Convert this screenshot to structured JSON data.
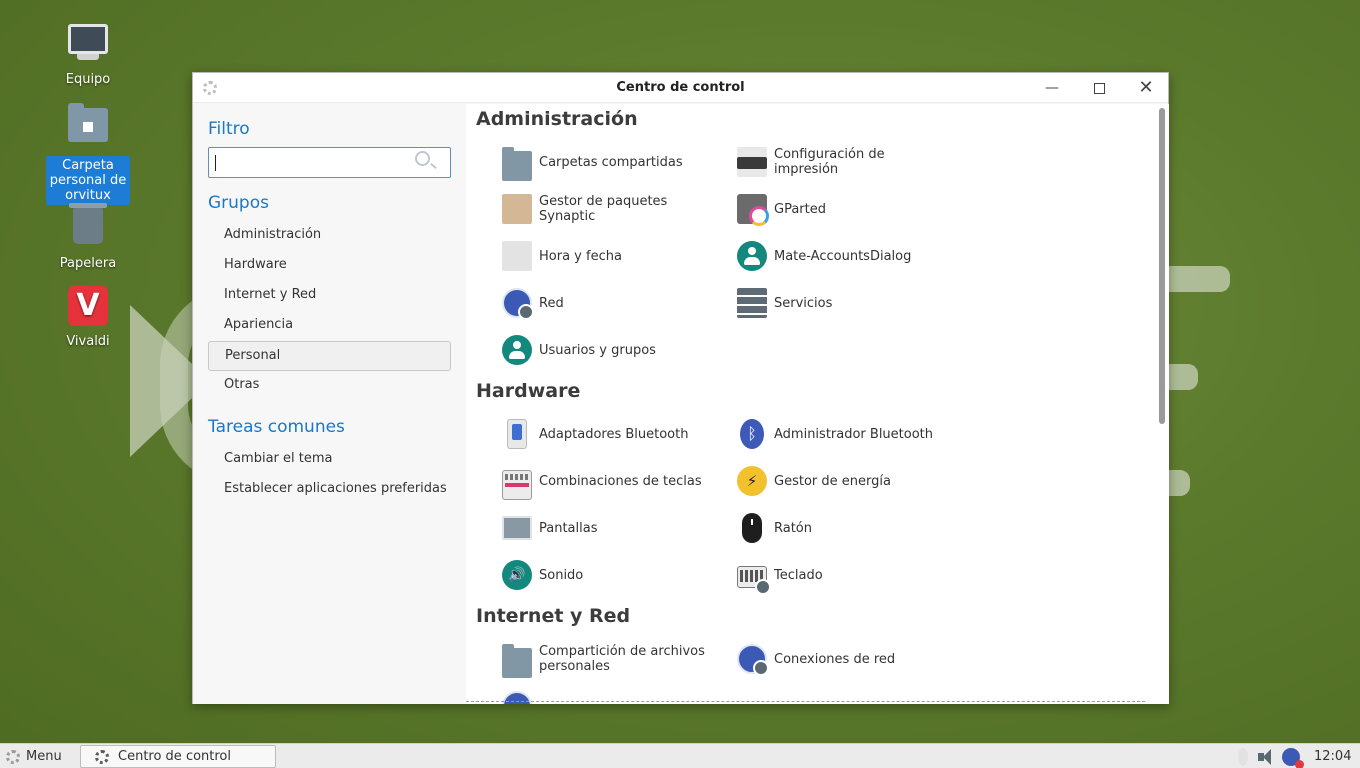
{
  "desktop": {
    "icons": [
      {
        "label": "Equipo"
      },
      {
        "label": "Carpeta personal de orvitux"
      },
      {
        "label": "Papelera"
      },
      {
        "label": "Vivaldi"
      }
    ]
  },
  "window": {
    "title": "Centro de control",
    "sidebar": {
      "filter_heading": "Filtro",
      "search_value": "",
      "groups_heading": "Grupos",
      "groups": [
        "Administración",
        "Hardware",
        "Internet y Red",
        "Apariencia",
        "Personal",
        "Otras"
      ],
      "active_group": "Personal",
      "tasks_heading": "Tareas comunes",
      "tasks": [
        "Cambiar el tema",
        "Establecer aplicaciones preferidas"
      ]
    },
    "sections": {
      "admin": {
        "title": "Administración",
        "items": [
          {
            "label": "Carpetas compartidas",
            "icon": "shared-folder-icon"
          },
          {
            "label": "Configuración de impresión",
            "icon": "printer-icon"
          },
          {
            "label": "Gestor de paquetes Synaptic",
            "icon": "package-icon"
          },
          {
            "label": "GParted",
            "icon": "gparted-icon"
          },
          {
            "label": "Hora y fecha",
            "icon": "clock-icon"
          },
          {
            "label": "Mate-AccountsDialog",
            "icon": "user-icon"
          },
          {
            "label": "Red",
            "icon": "network-icon"
          },
          {
            "label": "Servicios",
            "icon": "server-icon"
          },
          {
            "label": "Usuarios y grupos",
            "icon": "users-icon"
          }
        ]
      },
      "hardware": {
        "title": "Hardware",
        "items": [
          {
            "label": "Adaptadores Bluetooth",
            "icon": "usb-bluetooth-icon"
          },
          {
            "label": "Administrador Bluetooth",
            "icon": "bluetooth-icon"
          },
          {
            "label": "Combinaciones de teclas",
            "icon": "keyboard-shortcuts-icon"
          },
          {
            "label": "Gestor de energía",
            "icon": "power-icon"
          },
          {
            "label": "Pantallas",
            "icon": "display-icon"
          },
          {
            "label": "Ratón",
            "icon": "mouse-icon"
          },
          {
            "label": "Sonido",
            "icon": "sound-icon"
          },
          {
            "label": "Teclado",
            "icon": "keyboard-icon"
          }
        ]
      },
      "internet": {
        "title": "Internet y Red",
        "items": [
          {
            "label": "Compartición de archivos personales",
            "icon": "file-sharing-icon"
          },
          {
            "label": "Conexiones de red",
            "icon": "network-connections-icon"
          }
        ]
      }
    }
  },
  "taskbar": {
    "menu_label": "Menu",
    "task_label": "Centro de control",
    "clock": "12:04"
  }
}
